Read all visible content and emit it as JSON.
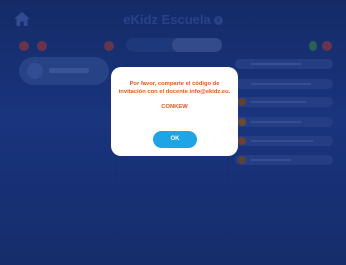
{
  "header": {
    "title": "eKidz Escuela",
    "info_icon": "info-icon",
    "home_icon": "home-icon"
  },
  "segment": {
    "left": "",
    "right": ""
  },
  "dialog": {
    "message": "Por favor, comparte el código de invitación con el docente info@ekidz.eu.",
    "code": "CONKEW",
    "ok_label": "OK"
  },
  "colors": {
    "accent": "#1ea4e7",
    "warning_text": "#e8541c",
    "background": "#1e3a8a"
  }
}
